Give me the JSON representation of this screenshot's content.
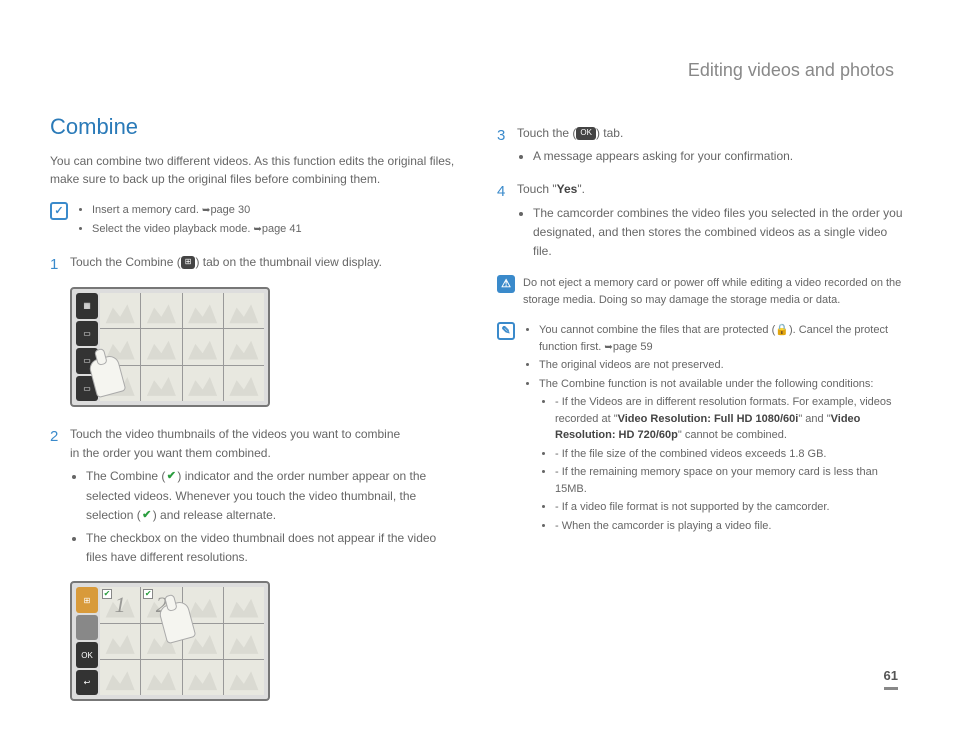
{
  "header": "Editing videos and photos",
  "title": "Combine",
  "intro": "You can combine two different videos. As this function edits the original files, make sure to back up the original files before combining them.",
  "prereq": {
    "items": [
      {
        "text": "Insert a memory card. ",
        "ref": "page 30"
      },
      {
        "text": "Select the video playback mode. ",
        "ref": "page 41"
      }
    ]
  },
  "step1": {
    "num": "1",
    "pre": "Touch the Combine (",
    "icon": "⊞",
    "post": ") tab on the thumbnail view display."
  },
  "step2": {
    "num": "2",
    "line1": "Touch the video thumbnails of the videos you want to combine",
    "line2": "in the order you want them combined.",
    "bullets": [
      {
        "t1": "The Combine (",
        "t2": ") indicator and the order number appear on the selected videos. Whenever you touch the video thumbnail, the selection (",
        "t3": ") and release alternate."
      },
      {
        "t1": "The checkbox on the video thumbnail does not appear if the video files have different resolutions."
      }
    ]
  },
  "step3": {
    "num": "3",
    "pre": "Touch the (",
    "icon": "OK",
    "post": ") tab.",
    "bullet": "A message appears asking for your confirmation."
  },
  "step4": {
    "num": "4",
    "pre": "Touch \"",
    "yes": "Yes",
    "post": "\".",
    "bullet": "The camcorder combines the video files you selected in the order you designated, and then stores the combined videos as a single video file."
  },
  "warning": "Do not eject a memory card or power off while editing a video recorded on the storage media. Doing so may damage the storage media or data.",
  "notes": {
    "b1_pre": "You cannot combine the files that are protected (",
    "b1_post": "). Cancel the protect function first. ",
    "b1_ref": "page 59",
    "b2": "The original videos are not preserved.",
    "b3": "The Combine function is not available under the following conditions:",
    "sub": [
      {
        "pre": "If the Videos are in different resolution formats. For example, videos recorded at \"",
        "bold1": "Video Resolution: Full HD  1080/60i",
        "mid": "\" and \"",
        "bold2": "Video Resolution: HD  720/60p",
        "post": "\" cannot be combined."
      },
      {
        "text": "If the file size of the combined videos exceeds 1.8 GB."
      },
      {
        "text": "If the remaining memory space on your memory card is less than 15MB."
      },
      {
        "text": "If a video file format is not supported by the camcorder."
      },
      {
        "text": "When the camcorder is playing a video file."
      }
    ]
  },
  "page_number": "61"
}
